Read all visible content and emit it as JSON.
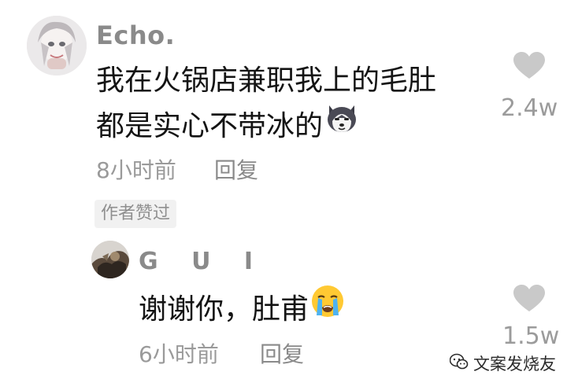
{
  "comment": {
    "username": "Echo.",
    "text_line1": "我在火锅店兼职我上的毛肚",
    "text_line2": "都是实心不带冰的",
    "emoji": "husky-dog-emoji",
    "time": "8小时前",
    "reply_label": "回复",
    "badge": "作者赞过",
    "likes": "2.4w"
  },
  "reply": {
    "username": "G U I",
    "text": "谢谢你，肚甫",
    "emoji": "loudly-crying-emoji",
    "time": "6小时前",
    "reply_label": "回复",
    "likes": "1.5w"
  },
  "watermark": {
    "text": "文案发烧友",
    "icon": "wechat-logo-icon"
  },
  "colors": {
    "text": "#141414",
    "meta": "#9a9a9a",
    "heart": "#c9c9c9",
    "badge_bg": "#f1f1f1"
  }
}
